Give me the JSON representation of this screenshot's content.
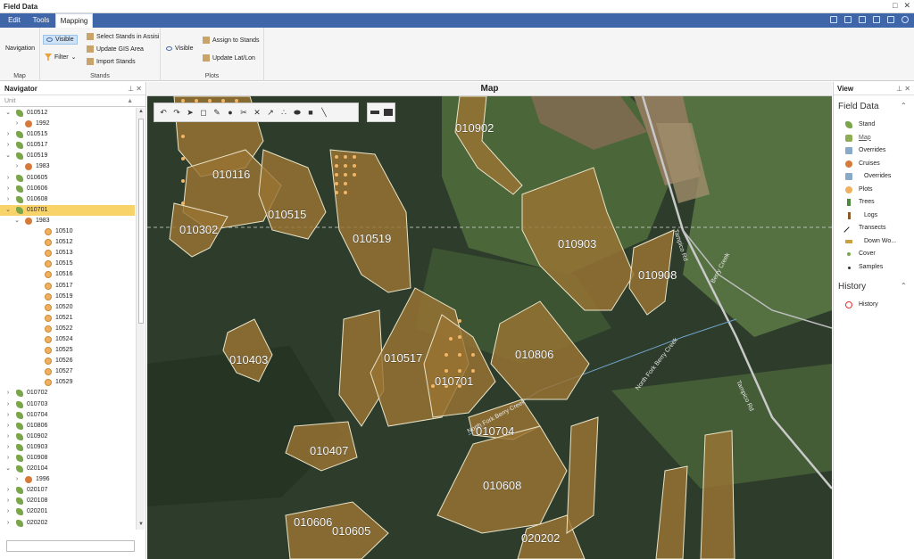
{
  "window": {
    "title": "Field Data"
  },
  "menu": {
    "tabs": [
      {
        "label": "Edit"
      },
      {
        "label": "Tools"
      },
      {
        "label": "Mapping",
        "active": true
      }
    ]
  },
  "ribbon": {
    "groups": {
      "map": {
        "label": "Map",
        "navigation": "Navigation"
      },
      "stands": {
        "label": "Stands",
        "visible": "Visible",
        "filter": "Filter",
        "select_stands": "Select Stands in Assisi",
        "update_gis": "Update GIS Area",
        "import_stands": "Import Stands"
      },
      "plots": {
        "label": "Plots",
        "visible": "Visible",
        "assign": "Assign to Stands",
        "update_latlon": "Update Lat/Lon"
      }
    }
  },
  "navigator": {
    "title": "Navigator",
    "column": "Unit",
    "rows": [
      {
        "label": "010512",
        "level": 0,
        "type": "stand",
        "expanded": true
      },
      {
        "label": "1992",
        "level": 1,
        "type": "cruise"
      },
      {
        "label": "010515",
        "level": 0,
        "type": "stand"
      },
      {
        "label": "010517",
        "level": 0,
        "type": "stand"
      },
      {
        "label": "010519",
        "level": 0,
        "type": "stand",
        "expanded": true
      },
      {
        "label": "1983",
        "level": 1,
        "type": "cruise"
      },
      {
        "label": "010605",
        "level": 0,
        "type": "stand"
      },
      {
        "label": "010606",
        "level": 0,
        "type": "stand"
      },
      {
        "label": "010608",
        "level": 0,
        "type": "stand"
      },
      {
        "label": "010701",
        "level": 0,
        "type": "stand",
        "expanded": true,
        "selected": true
      },
      {
        "label": "1983",
        "level": 1,
        "type": "cruise",
        "expanded": true
      },
      {
        "label": "10510",
        "level": 2,
        "type": "plot"
      },
      {
        "label": "10512",
        "level": 2,
        "type": "plot"
      },
      {
        "label": "10513",
        "level": 2,
        "type": "plot"
      },
      {
        "label": "10515",
        "level": 2,
        "type": "plot"
      },
      {
        "label": "10516",
        "level": 2,
        "type": "plot"
      },
      {
        "label": "10517",
        "level": 2,
        "type": "plot"
      },
      {
        "label": "10519",
        "level": 2,
        "type": "plot"
      },
      {
        "label": "10520",
        "level": 2,
        "type": "plot"
      },
      {
        "label": "10521",
        "level": 2,
        "type": "plot"
      },
      {
        "label": "10522",
        "level": 2,
        "type": "plot"
      },
      {
        "label": "10524",
        "level": 2,
        "type": "plot"
      },
      {
        "label": "10525",
        "level": 2,
        "type": "plot"
      },
      {
        "label": "10526",
        "level": 2,
        "type": "plot"
      },
      {
        "label": "10527",
        "level": 2,
        "type": "plot"
      },
      {
        "label": "10529",
        "level": 2,
        "type": "plot"
      },
      {
        "label": "010702",
        "level": 0,
        "type": "stand"
      },
      {
        "label": "010703",
        "level": 0,
        "type": "stand"
      },
      {
        "label": "010704",
        "level": 0,
        "type": "stand"
      },
      {
        "label": "010806",
        "level": 0,
        "type": "stand"
      },
      {
        "label": "010902",
        "level": 0,
        "type": "stand"
      },
      {
        "label": "010903",
        "level": 0,
        "type": "stand"
      },
      {
        "label": "010908",
        "level": 0,
        "type": "stand"
      },
      {
        "label": "020104",
        "level": 0,
        "type": "stand",
        "expanded": true
      },
      {
        "label": "1996",
        "level": 1,
        "type": "cruise"
      },
      {
        "label": "020107",
        "level": 0,
        "type": "stand"
      },
      {
        "label": "020108",
        "level": 0,
        "type": "stand"
      },
      {
        "label": "020201",
        "level": 0,
        "type": "stand"
      },
      {
        "label": "020202",
        "level": 0,
        "type": "stand"
      },
      {
        "label": "020205",
        "level": 0,
        "type": "stand"
      }
    ]
  },
  "map": {
    "title": "Map",
    "stand_labels": [
      "010902",
      "010116",
      "010515",
      "010302",
      "010519",
      "010903",
      "010908",
      "010403",
      "010517",
      "010806",
      "010701",
      "010704",
      "010407",
      "010608",
      "010606",
      "010605",
      "020202"
    ],
    "road_labels": [
      "Tampico Rd",
      "Berry Creek",
      "North Fork Berry Creek",
      "North Fork Berry Creek",
      "Tampico Rd"
    ],
    "colors": {
      "stand_fill": "#9a7433",
      "stand_edge": "#e9e3c8",
      "plot_dot": "#f2b565"
    }
  },
  "view": {
    "title": "View",
    "field_data": {
      "heading": "Field Data",
      "items": [
        {
          "label": "Stand",
          "icon": "stand-icon"
        },
        {
          "label": "Map",
          "icon": "map-icon",
          "link": true
        },
        {
          "label": "Overrides",
          "icon": "overrides-icon"
        },
        {
          "label": "Cruises",
          "icon": "cruise-icon"
        },
        {
          "label": "Overrides",
          "icon": "overrides-icon"
        },
        {
          "label": "Plots",
          "icon": "plot-icon"
        },
        {
          "label": "Trees",
          "icon": "tree-icon"
        },
        {
          "label": "Logs",
          "icon": "log-icon"
        },
        {
          "label": "Transects",
          "icon": "transect-icon"
        },
        {
          "label": "Down Wo...",
          "icon": "down-wood-icon"
        },
        {
          "label": "Cover",
          "icon": "cover-icon"
        },
        {
          "label": "Samples",
          "icon": "sample-icon"
        }
      ]
    },
    "history": {
      "heading": "History",
      "items": [
        {
          "label": "History",
          "icon": "history-icon"
        }
      ]
    }
  }
}
